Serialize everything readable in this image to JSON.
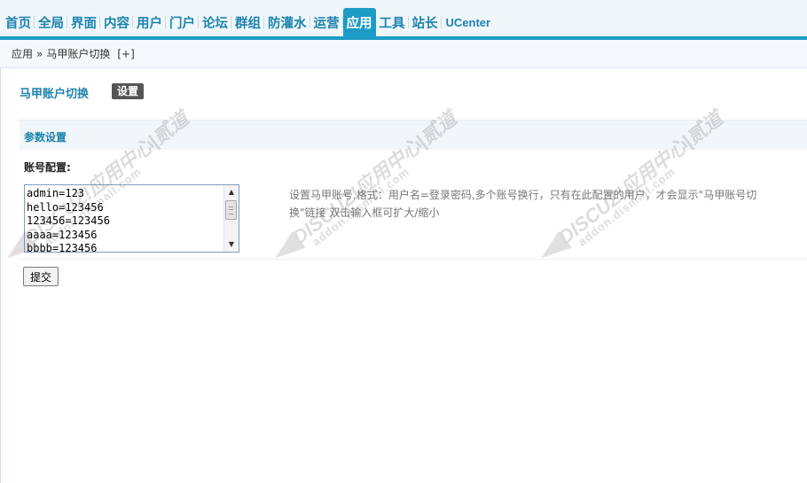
{
  "nav": {
    "items": [
      {
        "label": "首页",
        "active": false
      },
      {
        "label": "全局",
        "active": false
      },
      {
        "label": "界面",
        "active": false
      },
      {
        "label": "内容",
        "active": false
      },
      {
        "label": "用户",
        "active": false
      },
      {
        "label": "门户",
        "active": false
      },
      {
        "label": "论坛",
        "active": false
      },
      {
        "label": "群组",
        "active": false
      },
      {
        "label": "防灌水",
        "active": false
      },
      {
        "label": "运营",
        "active": false
      },
      {
        "label": "应用",
        "active": true
      },
      {
        "label": "工具",
        "active": false
      },
      {
        "label": "站长",
        "active": false
      },
      {
        "label": "UCenter",
        "active": false
      }
    ]
  },
  "breadcrumb": {
    "root": "应用",
    "separator": "»",
    "current": "马甲账户切换",
    "add": "[+]"
  },
  "page": {
    "title": "马甲账户切换",
    "tab_settings": "设置"
  },
  "section": {
    "title": "参数设置"
  },
  "form": {
    "account_label": "账号配置:",
    "account_lines": [
      "admin=123",
      "hello=123456",
      "123456=123456",
      "aaaa=123456",
      "bbbb=123456"
    ],
    "tip": "设置马甲账号,格式：用户名=登录密码,多个账号换行，只有在此配置的用户，才会显示\"马甲账号切换\"链接 双击输入框可扩大/缩小",
    "submit_label": "提交"
  },
  "watermark": {
    "brand": "DISCUZ!应用中心|贰道",
    "domain": "addon.dismall.com"
  },
  "colors": {
    "accent": "#1d9bc7",
    "link": "#1d83ad",
    "nav_bg": "#f0f7fb",
    "section_bg": "#f0f6fa"
  }
}
